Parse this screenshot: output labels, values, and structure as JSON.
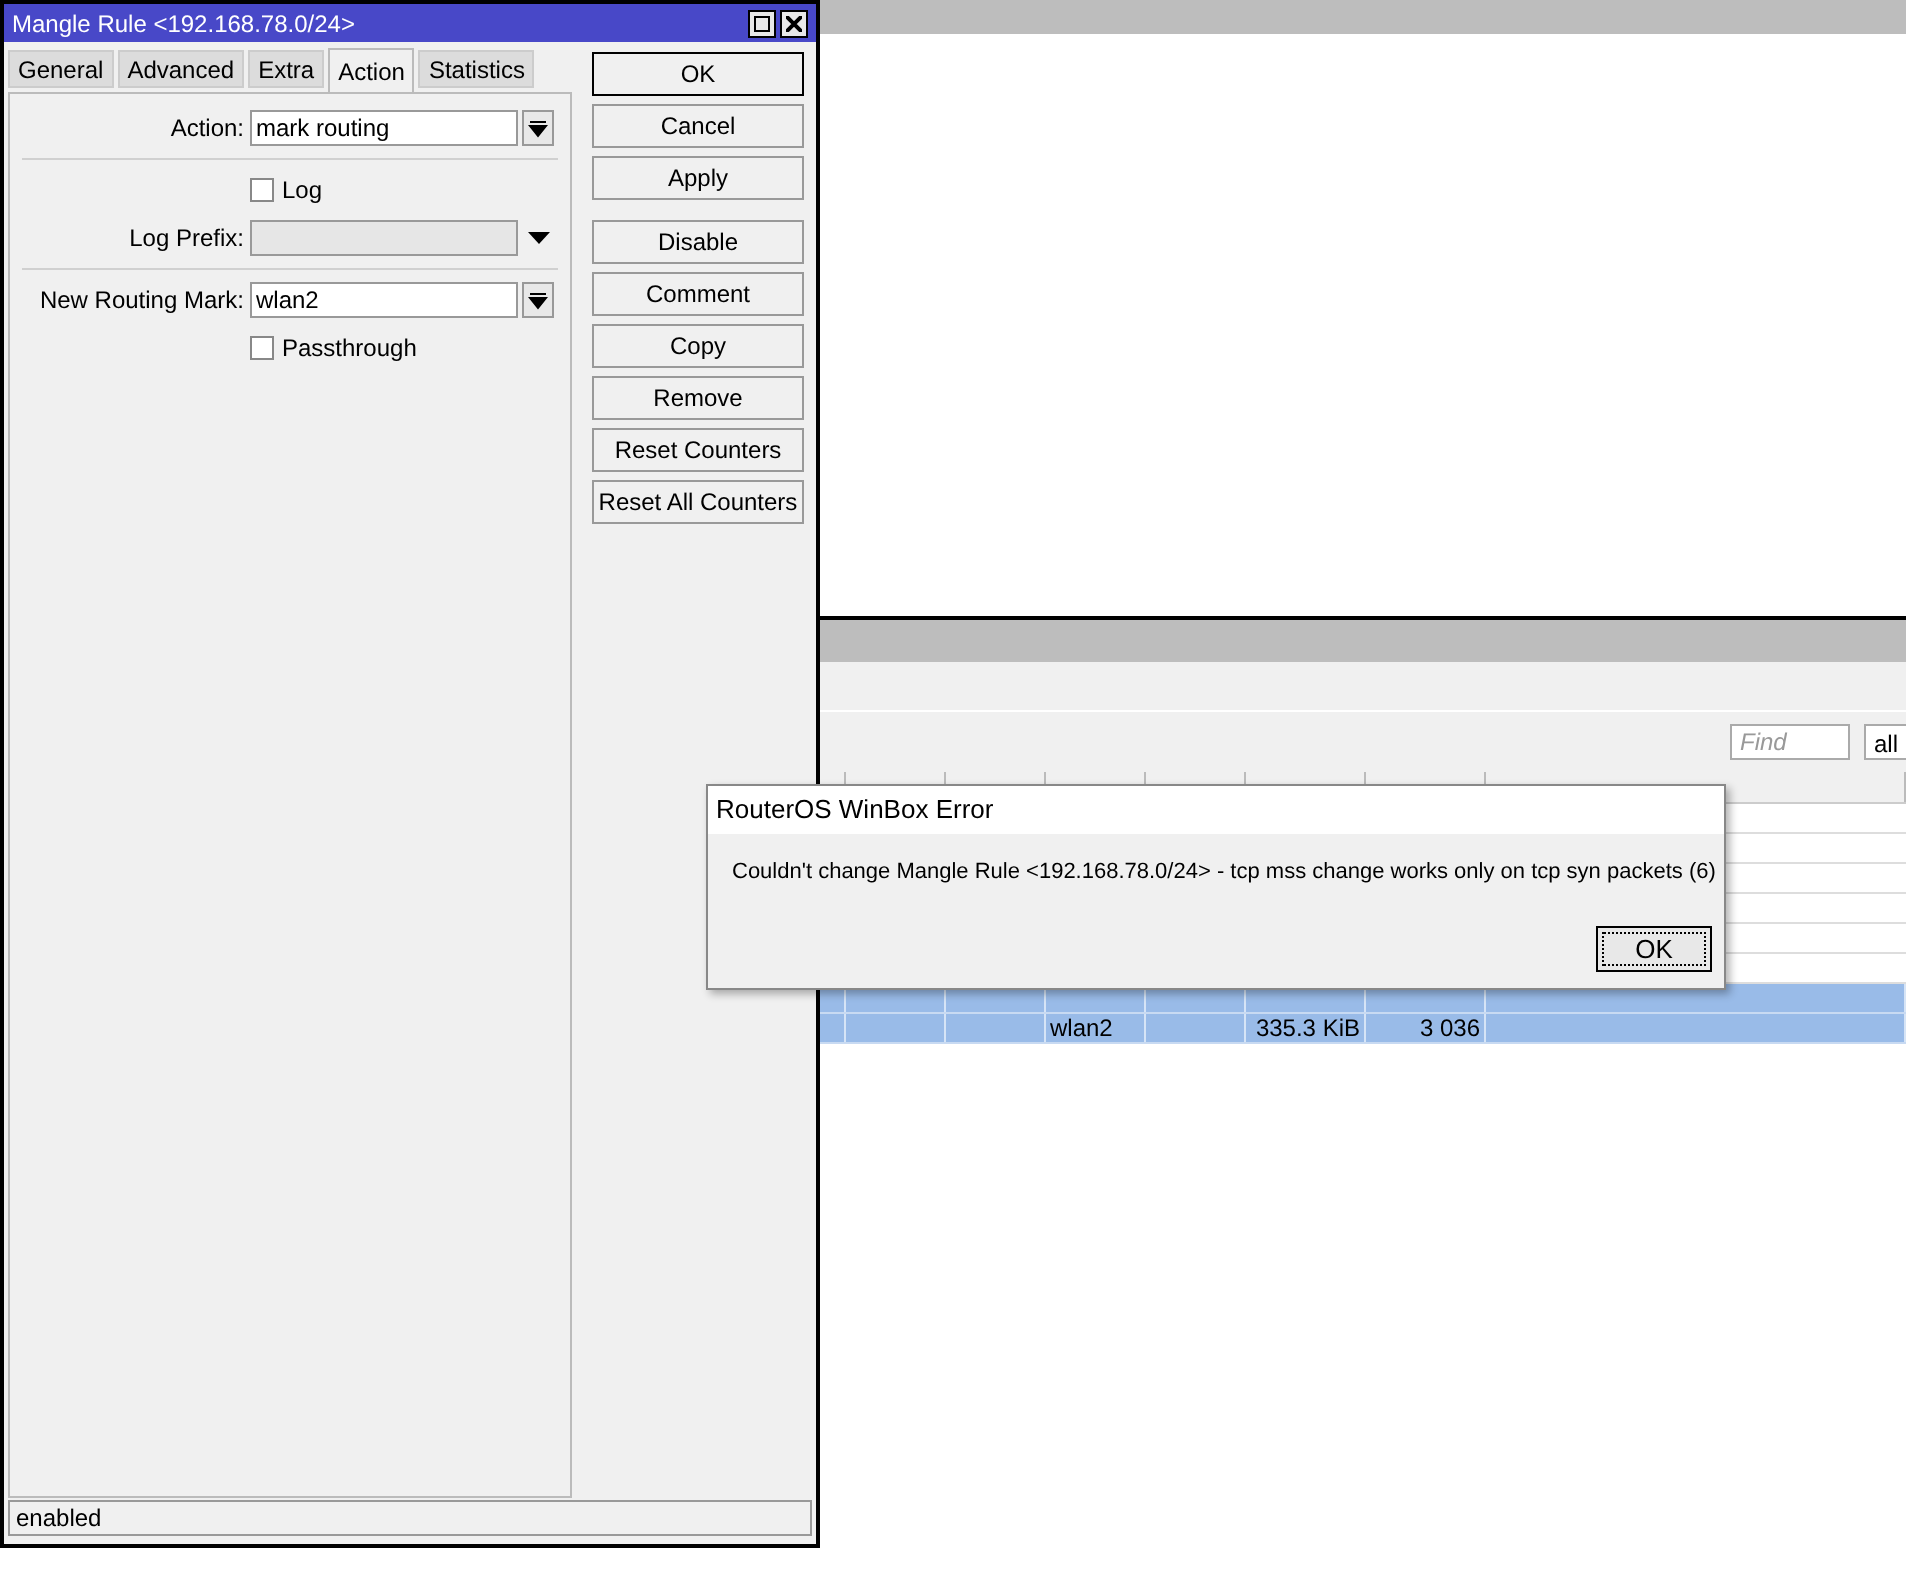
{
  "mangle_window": {
    "title": "Mangle Rule <192.168.78.0/24>",
    "tabs": [
      {
        "label": "General",
        "selected": false
      },
      {
        "label": "Advanced",
        "selected": false
      },
      {
        "label": "Extra",
        "selected": false
      },
      {
        "label": "Action",
        "selected": true
      },
      {
        "label": "Statistics",
        "selected": false
      }
    ],
    "fields": [
      {
        "kind": "dropdown",
        "label": "Action:",
        "value": "mark routing"
      },
      {
        "kind": "checkbox",
        "label": "Log",
        "checked": false
      },
      {
        "kind": "text",
        "label": "Log Prefix:",
        "disabled": true
      },
      {
        "kind": "dropdown",
        "label": "New Routing Mark:",
        "value": "wlan2"
      },
      {
        "kind": "checkbox",
        "label": "Passthrough",
        "checked": false
      }
    ],
    "buttons": [
      "OK",
      "Cancel",
      "Apply",
      "Disable",
      "Comment",
      "Copy",
      "Remove",
      "Reset Counters",
      "Reset All Counters"
    ],
    "status_bar": "enabled"
  },
  "list_window": {
    "find": {
      "placeholder": "Find"
    },
    "filter": "all",
    "rows": [
      {
        "selected": false,
        "cells": []
      },
      {
        "selected": false,
        "cells": []
      },
      {
        "selected": false,
        "cells": []
      },
      {
        "selected": false,
        "cells": []
      },
      {
        "selected": false,
        "cells": []
      },
      {
        "selected": false,
        "cells": []
      },
      {
        "selected": true,
        "cells": []
      },
      {
        "selected": true,
        "cells": [
          "",
          "",
          "",
          "wlan2",
          "",
          "335.3 KiB",
          "3 036"
        ]
      }
    ]
  },
  "error_dialog": {
    "title": "RouterOS WinBox Error",
    "message": "Couldn't change Mangle Rule <192.168.78.0/24> - tcp mss change works only on tcp syn packets (6)",
    "button": "OK"
  }
}
